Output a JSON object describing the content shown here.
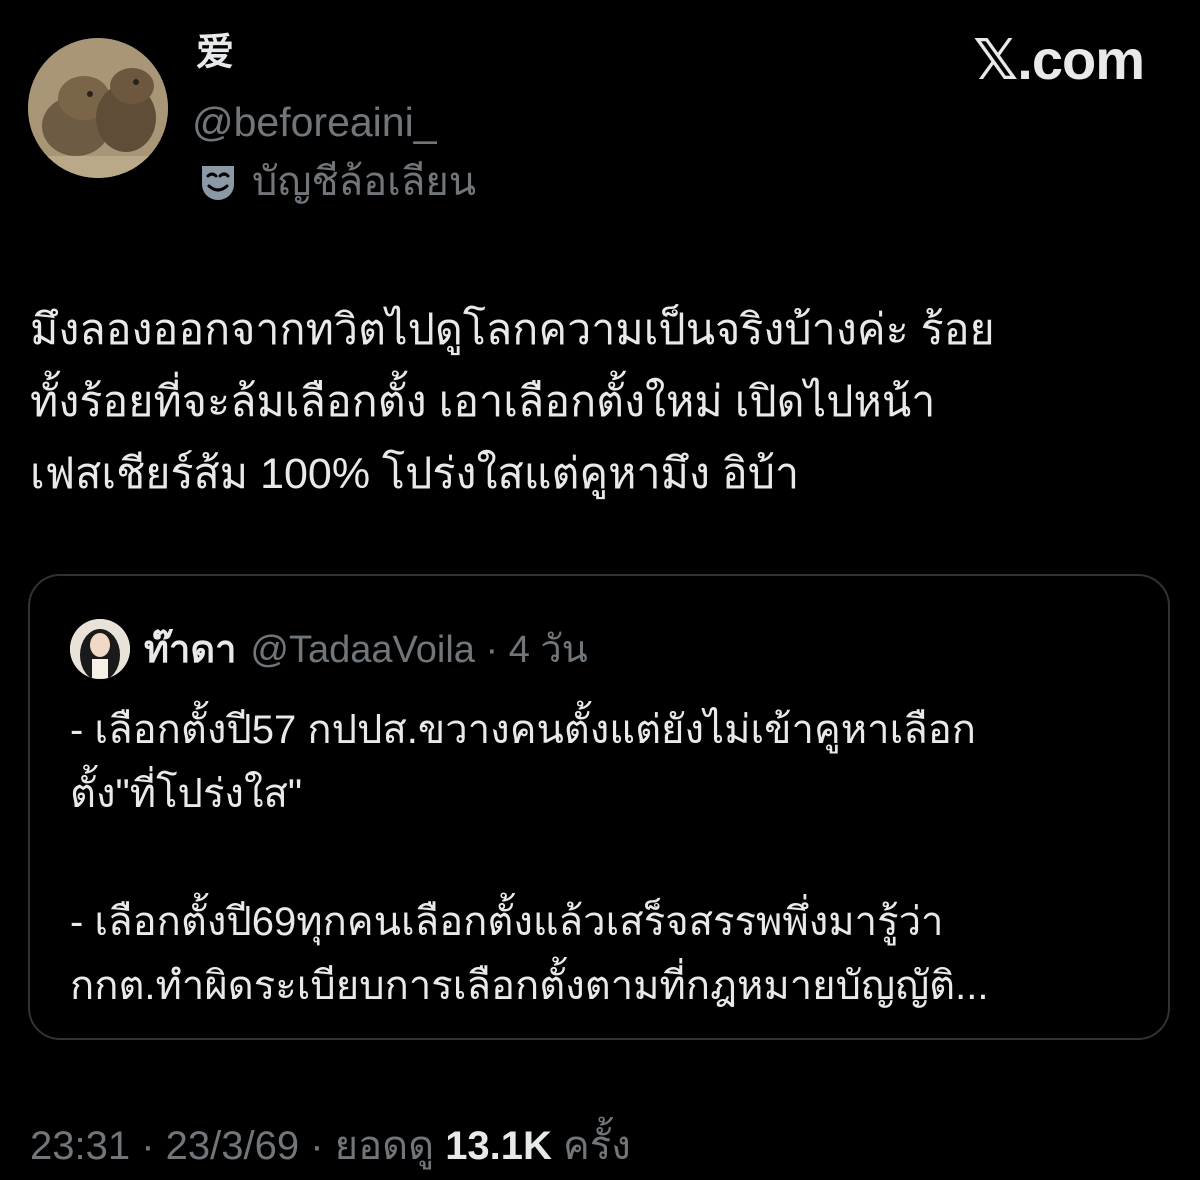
{
  "brand": {
    "label": "𝕏.com"
  },
  "author": {
    "display_name": "爱",
    "handle": "@beforeaini_",
    "parody_label": "บัญชีล้อเลียน",
    "avatar_icon": "capybara-avatar",
    "parody_icon": "theater-mask-icon"
  },
  "tweet": {
    "text": "มึงลองออกจากทวิตไปดูโลกความเป็นจริงบ้างค่ะ ร้อย\nทั้งร้อยที่จะล้มเลือกตั้ง เอาเลือกตั้งใหม่ เปิดไปหน้า\nเฟสเชียร์ส้ม 100% โปร่งใสแต่คูหามึง อิบ้า"
  },
  "quote": {
    "display_name": "ท๊าดา",
    "meta": "@TadaaVoila · 4 วัน",
    "avatar_icon": "user-avatar",
    "text": "- เลือกตั้งปี57 กปปส.ขวางคนตั้งแต่ยังไม่เข้าคูหาเลือก\nตั้ง\"ที่โปร่งใส\"\n\n- เลือกตั้งปี69ทุกคนเลือกตั้งแล้วเสร็จสรรพพึ่งมารู้ว่า\nกกต.ทำผิดระเบียบการเลือกตั้งตามที่กฎหมายบัญญัติ..."
  },
  "footer": {
    "timestamp": "23:31 · 23/3/69 · ยอดดู ",
    "views_count": "13.1K",
    "views_suffix": " ครั้ง"
  },
  "colors": {
    "background": "#000000",
    "primary_text": "#e7e9ea",
    "secondary_text": "#71767b",
    "card_border": "#2f3336"
  }
}
